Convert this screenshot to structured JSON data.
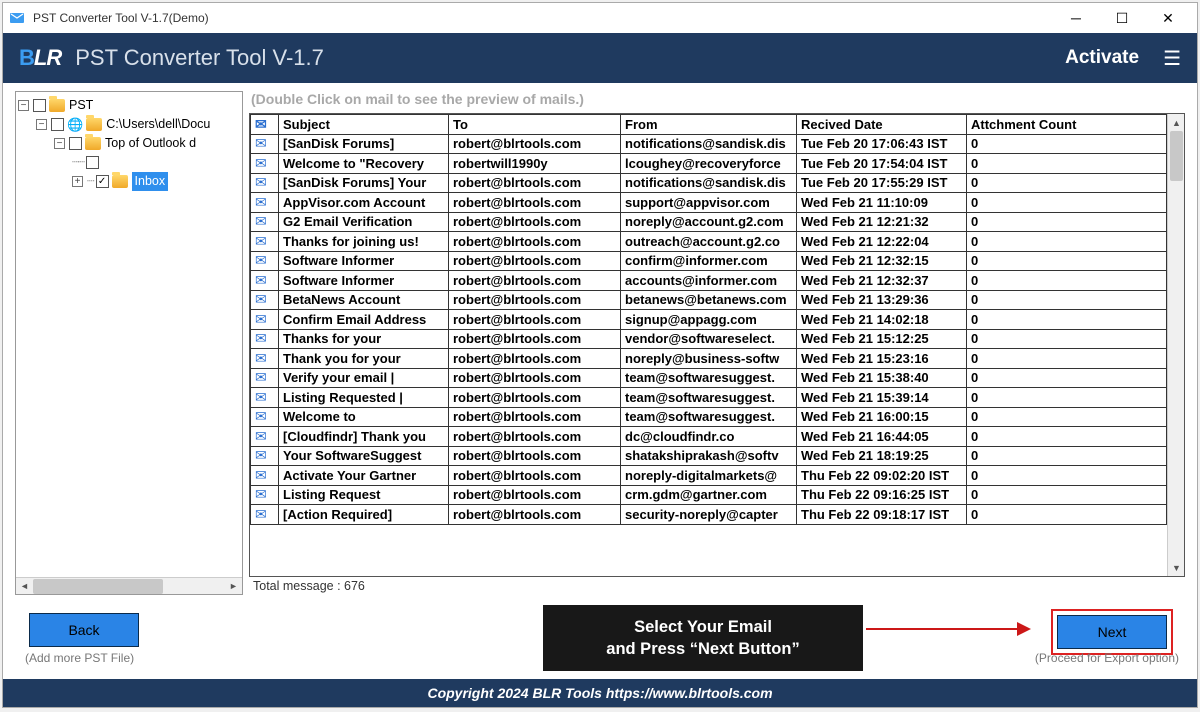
{
  "titlebar": {
    "title": "PST Converter Tool V-1.7(Demo)"
  },
  "header": {
    "title": "PST Converter Tool V-1.7",
    "activate": "Activate"
  },
  "tree": {
    "root": "PST",
    "path": "C:\\Users\\dell\\Docu",
    "top": "Top of Outlook d",
    "inbox": "Inbox"
  },
  "hint": "(Double Click on mail to see the preview of mails.)",
  "columns": {
    "subject": "Subject",
    "to": "To",
    "from": "From",
    "date": "Recived Date",
    "att": "Attchment Count"
  },
  "rows": [
    {
      "subject": "[SanDisk Forums]",
      "to": "robert@blrtools.com",
      "from": "notifications@sandisk.dis",
      "date": "Tue Feb 20 17:06:43 IST",
      "att": "0"
    },
    {
      "subject": "Welcome to \"Recovery",
      "to": "robertwill1990y",
      "from": "lcoughey@recoveryforce",
      "date": "Tue Feb 20 17:54:04 IST",
      "att": "0"
    },
    {
      "subject": "[SanDisk Forums] Your",
      "to": "robert@blrtools.com",
      "from": "notifications@sandisk.dis",
      "date": "Tue Feb 20 17:55:29 IST",
      "att": "0"
    },
    {
      "subject": "AppVisor.com Account",
      "to": "robert@blrtools.com",
      "from": "support@appvisor.com",
      "date": "Wed Feb 21 11:10:09",
      "att": "0"
    },
    {
      "subject": "G2 Email Verification",
      "to": "robert@blrtools.com",
      "from": "noreply@account.g2.com",
      "date": "Wed Feb 21 12:21:32",
      "att": "0"
    },
    {
      "subject": "Thanks for joining us!",
      "to": "robert@blrtools.com",
      "from": "outreach@account.g2.co",
      "date": "Wed Feb 21 12:22:04",
      "att": "0"
    },
    {
      "subject": "Software Informer",
      "to": "robert@blrtools.com",
      "from": "confirm@informer.com",
      "date": "Wed Feb 21 12:32:15",
      "att": "0"
    },
    {
      "subject": "Software Informer",
      "to": "robert@blrtools.com",
      "from": "accounts@informer.com",
      "date": "Wed Feb 21 12:32:37",
      "att": "0"
    },
    {
      "subject": "BetaNews Account",
      "to": "robert@blrtools.com",
      "from": "betanews@betanews.com",
      "date": "Wed Feb 21 13:29:36",
      "att": "0"
    },
    {
      "subject": "Confirm Email Address",
      "to": "robert@blrtools.com",
      "from": "signup@appagg.com",
      "date": "Wed Feb 21 14:02:18",
      "att": "0"
    },
    {
      "subject": "Thanks for your",
      "to": "robert@blrtools.com",
      "from": "vendor@softwareselect.",
      "date": "Wed Feb 21 15:12:25",
      "att": "0"
    },
    {
      "subject": "Thank you for your",
      "to": "robert@blrtools.com",
      "from": "noreply@business-softw",
      "date": "Wed Feb 21 15:23:16",
      "att": "0"
    },
    {
      "subject": "Verify your email |",
      "to": "robert@blrtools.com",
      "from": "team@softwaresuggest.",
      "date": "Wed Feb 21 15:38:40",
      "att": "0"
    },
    {
      "subject": "Listing Requested |",
      "to": "robert@blrtools.com",
      "from": "team@softwaresuggest.",
      "date": "Wed Feb 21 15:39:14",
      "att": "0"
    },
    {
      "subject": "Welcome to",
      "to": "robert@blrtools.com",
      "from": "team@softwaresuggest.",
      "date": "Wed Feb 21 16:00:15",
      "att": "0"
    },
    {
      "subject": "[Cloudfindr] Thank you",
      "to": "robert@blrtools.com",
      "from": "dc@cloudfindr.co",
      "date": "Wed Feb 21 16:44:05",
      "att": "0"
    },
    {
      "subject": "Your SoftwareSuggest",
      "to": "robert@blrtools.com",
      "from": "shatakshiprakash@softv",
      "date": "Wed Feb 21 18:19:25",
      "att": "0"
    },
    {
      "subject": "Activate Your Gartner",
      "to": "robert@blrtools.com",
      "from": "noreply-digitalmarkets@",
      "date": "Thu Feb 22 09:02:20 IST",
      "att": "0"
    },
    {
      "subject": "Listing Request",
      "to": "robert@blrtools.com",
      "from": "crm.gdm@gartner.com",
      "date": "Thu Feb 22 09:16:25 IST",
      "att": "0"
    },
    {
      "subject": "[Action Required]",
      "to": "robert@blrtools.com",
      "from": "security-noreply@capter",
      "date": "Thu Feb 22 09:18:17 IST",
      "att": "0"
    }
  ],
  "total": "Total message : 676",
  "buttons": {
    "back": "Back",
    "back_help": "(Add more PST File)",
    "next": "Next",
    "next_help": "(Proceed for Export option)"
  },
  "callout": {
    "l1": "Select Your Email",
    "l2": "and Press “Next Button”"
  },
  "copyright": "Copyright 2024 BLR Tools https://www.blrtools.com"
}
